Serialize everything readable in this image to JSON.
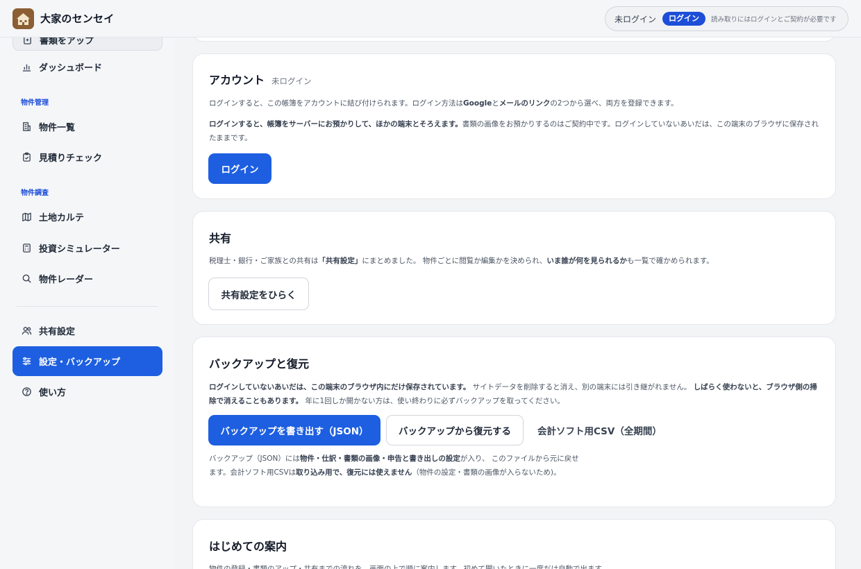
{
  "header": {
    "app_title": "大家のセンセイ",
    "status_text": "未ログイン",
    "login_button": "ログイン",
    "status_note": "読み取りにはログインとご契約が必要です"
  },
  "sidebar": {
    "clipped_item": "書類をアップ",
    "dashboard": "ダッシュボード",
    "section_property_mgmt": "物件管理",
    "property_list": "物件一覧",
    "estimate_check": "見積りチェック",
    "section_property_research": "物件調査",
    "land_karte": "土地カルテ",
    "investment_sim": "投資シミュレーター",
    "property_radar": "物件レーダー",
    "share_settings": "共有設定",
    "settings_backup": "設定・バックアップ",
    "how_to_use": "使い方"
  },
  "account": {
    "title": "アカウント",
    "status": "未ログイン",
    "p1_a": "ログインすると、この帳簿をアカウントに結び付けられます。ログイン方法は",
    "p1_b": "Google",
    "p1_c": "と",
    "p1_d": "メールのリンク",
    "p1_e": "の2つから選べ、両方を登録できます。",
    "p2_a": "ログインすると、帳簿をサーバーにお預かりして、ほかの端末とそろえます。",
    "p2_b": "書類の画像をお預かりするのはご契約中です。ログインしていないあいだは、この端末のブラウザに保存されたままです。",
    "login_button": "ログイン"
  },
  "share": {
    "title": "共有",
    "p_a": "税理士・銀行・ご家族との共有は",
    "p_b": "「共有設定」",
    "p_c": "にまとめました。 物件ごとに閲覧か編集かを決められ、",
    "p_d": "いま誰が何を見られるか",
    "p_e": "も一覧で確かめられます。",
    "open_button": "共有設定をひらく"
  },
  "backup": {
    "title": "バックアップと復元",
    "p1_a": "ログインしていないあいだは、この端末のブラウザ内にだけ保存されています。",
    "p1_b": " サイトデータを削除すると消え、別の端末には引き継がれません。 ",
    "p1_c": "しばらく使わないと、ブラウザ側の掃除で消えることもあります。",
    "p1_d": " 年に1回しか開かない方は、使い終わりに必ずバックアップを取ってください。",
    "export_button": "バックアップを書き出す（JSON）",
    "restore_button": "バックアップから復元する",
    "csv_button": "会計ソフト用CSV（全期間）",
    "n_a": "バックアップ（JSON）には",
    "n_b": "物件・仕訳・書類の画像・申告と書き出しの設定",
    "n_c": "が入り、 このファイルから元に戻せます。会計ソフト用CSVは",
    "n_d": "取り込み用で、復元には使えません",
    "n_e": "（物件の設定・書類の画像が入らないため)。"
  },
  "intro": {
    "title": "はじめての案内",
    "p": "物件の登録・書類のアップ・共有までの流れを、画面の上で順に案内します。初めて開いたときに一度だけ自動で出ます。"
  }
}
